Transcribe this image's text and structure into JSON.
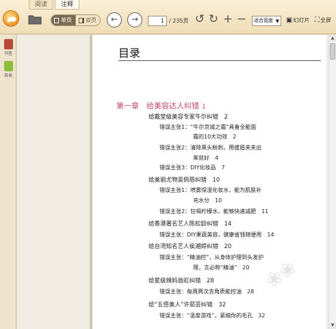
{
  "tabs": [
    {
      "label": "阅读"
    },
    {
      "label": "注释"
    }
  ],
  "toolbar": {
    "view_single": "单页",
    "view_double": "双页",
    "page_current": "1",
    "page_total": "/ 235页",
    "zoom_value": "适合宽度",
    "slideshow_label": "幻灯片",
    "fullscreen_label": "全屏",
    "icons": {
      "logo": "app-logo-icon",
      "open": "folder-icon",
      "prev": "arrow-left-icon",
      "next": "arrow-right-icon",
      "rotate_left": "rotate-ccw-icon",
      "rotate_right": "rotate-cw-icon",
      "zoom_in": "plus-icon",
      "zoom_out": "minus-icon"
    }
  },
  "sidebar": {
    "items": [
      {
        "label": "书签",
        "icon": "bookmark-icon"
      },
      {
        "label": "目录",
        "icon": "toc-icon"
      }
    ]
  },
  "document": {
    "title": "目录",
    "chapter": {
      "label": "第一章　给美容达人纠错",
      "page": "1"
    },
    "entries": [
      {
        "text": "给戴堂级美容专家牛尔纠错　2"
      },
      {
        "text": "错误主张1：“牛尔京城之霜”具备全能面"
      },
      {
        "text": "霜的10大功效　2"
      },
      {
        "text": "错误主张2：清除黑头粉刺，用拔眉夹夹出"
      },
      {
        "text": "来就好　4"
      },
      {
        "text": "错误主张3：DIY化妆品　7"
      },
      {
        "text": "给美丽尤物吴佩慈纠错　10"
      },
      {
        "text": "错误主张1：喷雾保湿化妆水，能为肌肤补"
      },
      {
        "text": "充水分　10"
      },
      {
        "text": "错误主张2：狂喝柠檬水，能够快速减肥　11"
      },
      {
        "text": "给香港著名艺人陈松龄纠错　14"
      },
      {
        "text": "错误主张：DIY果蔬美容，健康省钱随便用　14"
      },
      {
        "text": "给台湾知名艺人侯湘婷纠错　20"
      },
      {
        "text": "错误主张：“精油控”，从身体护理到头发护"
      },
      {
        "text": "理，言必称“精油”　20"
      },
      {
        "text": "给星级辣妈翁虹纠错　28"
      },
      {
        "text": "错误主张：每周两次去角质能控油　28"
      },
      {
        "text": "给“五感美人”许茹芸纠错　32"
      },
      {
        "text": "错误主张：“温度游戏”，紧缩你的毛孔　32"
      }
    ]
  }
}
